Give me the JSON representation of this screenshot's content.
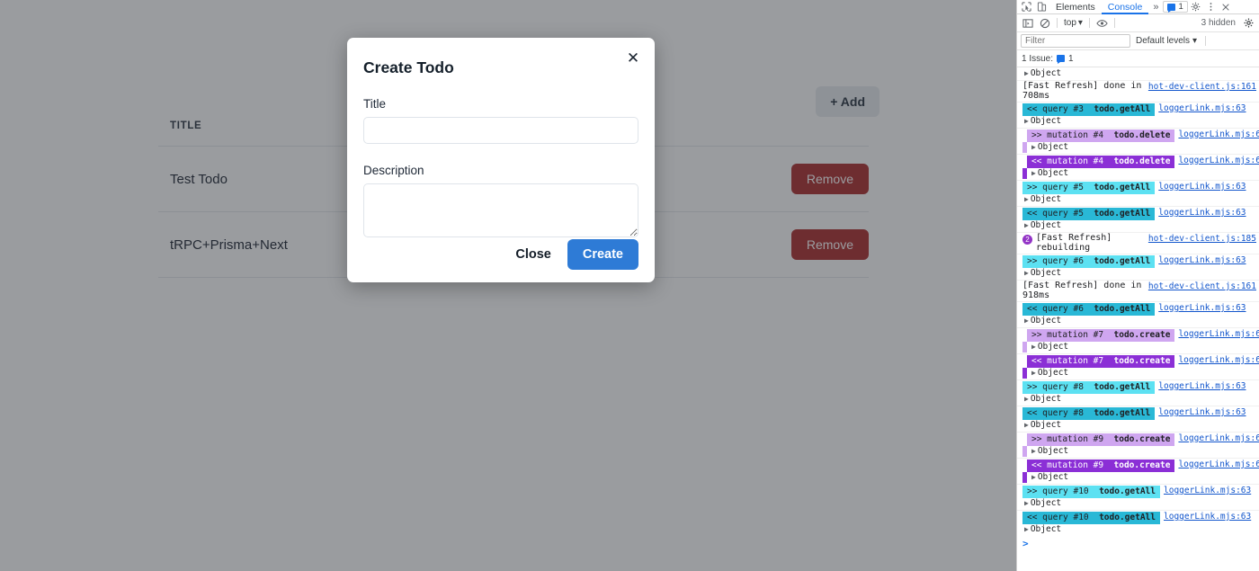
{
  "page": {
    "add_button": "+ Add",
    "table": {
      "columns": [
        "TITLE",
        ""
      ],
      "rows": [
        {
          "title": "Test Todo",
          "action": "Remove"
        },
        {
          "title": "tRPC+Prisma+Next",
          "action": "Remove"
        }
      ]
    }
  },
  "modal": {
    "title": "Create Todo",
    "close_icon": "close-icon",
    "fields": [
      {
        "label": "Title",
        "value": "",
        "placeholder": ""
      },
      {
        "label": "Description",
        "value": "",
        "placeholder": ""
      }
    ],
    "title_label": "Title",
    "title_value": "",
    "description_label": "Description",
    "description_value": "",
    "close_label": "Close",
    "create_label": "Create",
    "accent": "#2e7bd6"
  },
  "devtools": {
    "tabs": [
      {
        "label": "Elements",
        "active": false
      },
      {
        "label": "Console",
        "active": true
      }
    ],
    "more_tabs": "»",
    "tab_issue_count": "1",
    "settings_icon": "gear-icon",
    "menu_icon": "kebab-menu-icon",
    "close_icon": "close-icon",
    "inspect_icon": "inspect-element-icon",
    "device_icon": "device-toolbar-icon",
    "toolbar": {
      "sidebar_icon": "console-sidebar-icon",
      "clear_icon": "clear-console-icon",
      "context": "top",
      "eye_icon": "live-expression-eye-icon",
      "hidden_text": "3 hidden",
      "settings_icon": "console-settings-gear-icon"
    },
    "filterbar": {
      "filter_placeholder": "Filter",
      "filter_value": "",
      "levels": "Default levels"
    },
    "issuebar": {
      "label": "1 Issue:",
      "count": "1"
    },
    "prompt": ">",
    "colors": {
      "query_out": "#5ce1f2",
      "query_in": "#29b8d6",
      "mutation_out": "#cfa6f0",
      "mutation_in": "#8b2fd6",
      "link": "#1155cc"
    },
    "entries": [
      {
        "kind": "object",
        "text": "Object",
        "partial_top": true
      },
      {
        "kind": "plain",
        "text": "[Fast Refresh] done in 708ms",
        "source": "hot-dev-client.js:161"
      },
      {
        "kind": "trpc",
        "badge": "<< query #3",
        "op": "todo.getAll",
        "style": "query_in",
        "source": "loggerLink.mjs:63",
        "object": "Object"
      },
      {
        "kind": "trpc",
        "badge": ">> mutation #4",
        "op": "todo.delete",
        "style": "mutation_out",
        "source": "loggerLink.mjs:63",
        "object": "Object"
      },
      {
        "kind": "trpc",
        "badge": "<< mutation #4",
        "op": "todo.delete",
        "style": "mutation_in",
        "source": "loggerLink.mjs:63",
        "object": "Object"
      },
      {
        "kind": "trpc",
        "badge": ">> query #5",
        "op": "todo.getAll",
        "style": "query_out",
        "source": "loggerLink.mjs:63",
        "object": "Object"
      },
      {
        "kind": "trpc",
        "badge": "<< query #5",
        "op": "todo.getAll",
        "style": "query_in",
        "source": "loggerLink.mjs:63",
        "object": "Object"
      },
      {
        "kind": "plain",
        "text": "[Fast Refresh] rebuilding",
        "source": "hot-dev-client.js:185",
        "count": "2"
      },
      {
        "kind": "trpc",
        "badge": ">> query #6",
        "op": "todo.getAll",
        "style": "query_out",
        "source": "loggerLink.mjs:63",
        "object": "Object"
      },
      {
        "kind": "plain",
        "text": "[Fast Refresh] done in 918ms",
        "source": "hot-dev-client.js:161"
      },
      {
        "kind": "trpc",
        "badge": "<< query #6",
        "op": "todo.getAll",
        "style": "query_in",
        "source": "loggerLink.mjs:63",
        "object": "Object"
      },
      {
        "kind": "trpc",
        "badge": ">> mutation #7",
        "op": "todo.create",
        "style": "mutation_out",
        "source": "loggerLink.mjs:63",
        "object": "Object"
      },
      {
        "kind": "trpc",
        "badge": "<< mutation #7",
        "op": "todo.create",
        "style": "mutation_in",
        "source": "loggerLink.mjs:63",
        "object": "Object"
      },
      {
        "kind": "trpc",
        "badge": ">> query #8",
        "op": "todo.getAll",
        "style": "query_out",
        "source": "loggerLink.mjs:63",
        "object": "Object"
      },
      {
        "kind": "trpc",
        "badge": "<< query #8",
        "op": "todo.getAll",
        "style": "query_in",
        "source": "loggerLink.mjs:63",
        "object": "Object"
      },
      {
        "kind": "trpc",
        "badge": ">> mutation #9",
        "op": "todo.create",
        "style": "mutation_out",
        "source": "loggerLink.mjs:63",
        "object": "Object"
      },
      {
        "kind": "trpc",
        "badge": "<< mutation #9",
        "op": "todo.create",
        "style": "mutation_in",
        "source": "loggerLink.mjs:63",
        "object": "Object"
      },
      {
        "kind": "trpc",
        "badge": ">> query #10",
        "op": "todo.getAll",
        "style": "query_out",
        "source": "loggerLink.mjs:63",
        "object": "Object"
      },
      {
        "kind": "trpc",
        "badge": "<< query #10",
        "op": "todo.getAll",
        "style": "query_in",
        "source": "loggerLink.mjs:63",
        "object": "Object"
      }
    ]
  }
}
